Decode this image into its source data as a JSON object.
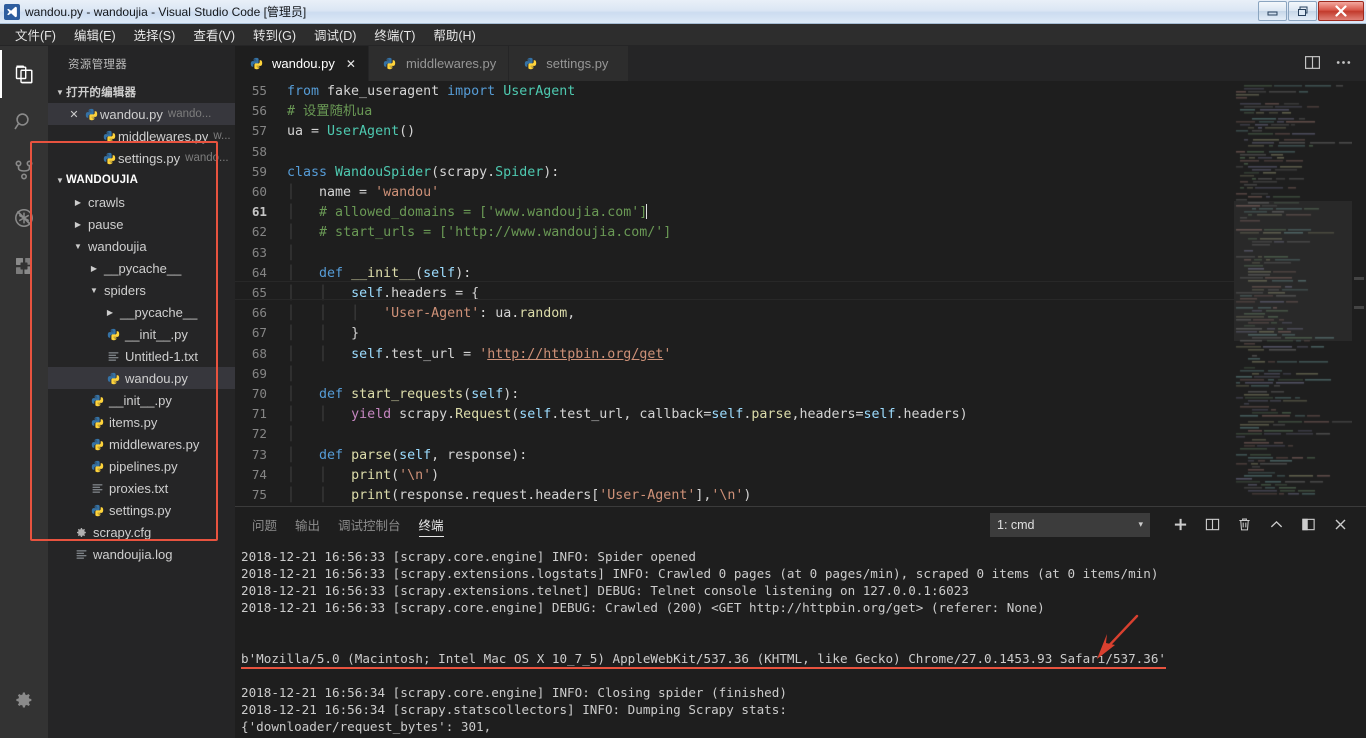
{
  "window": {
    "title": "wandou.py - wandoujia - Visual Studio Code [管理员]",
    "app_icon": "vscode-icon",
    "minimize_label": "—",
    "maximize_label": "❐",
    "close_label": "✕"
  },
  "menubar": {
    "items": [
      {
        "label": "文件(F)",
        "name": "menu-file"
      },
      {
        "label": "编辑(E)",
        "name": "menu-edit"
      },
      {
        "label": "选择(S)",
        "name": "menu-selection"
      },
      {
        "label": "查看(V)",
        "name": "menu-view"
      },
      {
        "label": "转到(G)",
        "name": "menu-go"
      },
      {
        "label": "调试(D)",
        "name": "menu-debug"
      },
      {
        "label": "终端(T)",
        "name": "menu-terminal"
      },
      {
        "label": "帮助(H)",
        "name": "menu-help"
      }
    ]
  },
  "activitybar": {
    "items": [
      {
        "icon": "files-explorer-icon",
        "active": true
      },
      {
        "icon": "search-icon",
        "active": false
      },
      {
        "icon": "source-control-icon",
        "active": false
      },
      {
        "icon": "debug-no-run-icon",
        "active": false
      },
      {
        "icon": "extensions-icon",
        "active": false
      }
    ],
    "bottom": [
      {
        "icon": "gear-icon",
        "active": false
      }
    ]
  },
  "sidebar": {
    "title": "资源管理器",
    "open_editors": {
      "label": "打开的编辑器",
      "expanded": true,
      "items": [
        {
          "name": "wandou.py",
          "desc": "wando...",
          "icon": "python-icon",
          "selected": true,
          "has_close": true
        },
        {
          "name": "middlewares.py",
          "desc": "w...",
          "icon": "python-icon",
          "selected": false,
          "has_close": false
        },
        {
          "name": "settings.py",
          "desc": "wando...",
          "icon": "python-icon",
          "selected": false,
          "has_close": false
        }
      ]
    },
    "project": {
      "label": "WANDOUJIA",
      "expanded": true,
      "tree": [
        {
          "label": "crawls",
          "type": "folder",
          "depth": 1,
          "expanded": false
        },
        {
          "label": "pause",
          "type": "folder",
          "depth": 1,
          "expanded": false
        },
        {
          "label": "wandoujia",
          "type": "folder",
          "depth": 1,
          "expanded": true
        },
        {
          "label": "__pycache__",
          "type": "folder",
          "depth": 2,
          "expanded": false
        },
        {
          "label": "spiders",
          "type": "folder",
          "depth": 2,
          "expanded": true
        },
        {
          "label": "__pycache__",
          "type": "folder",
          "depth": 3,
          "expanded": false
        },
        {
          "label": "__init__.py",
          "type": "python",
          "depth": 3
        },
        {
          "label": "Untitled-1.txt",
          "type": "text",
          "depth": 3
        },
        {
          "label": "wandou.py",
          "type": "python",
          "depth": 3,
          "selected": true
        },
        {
          "label": "__init__.py",
          "type": "python",
          "depth": 2
        },
        {
          "label": "items.py",
          "type": "python",
          "depth": 2
        },
        {
          "label": "middlewares.py",
          "type": "python",
          "depth": 2
        },
        {
          "label": "pipelines.py",
          "type": "python",
          "depth": 2
        },
        {
          "label": "proxies.txt",
          "type": "text",
          "depth": 2
        },
        {
          "label": "settings.py",
          "type": "python",
          "depth": 2
        },
        {
          "label": "scrapy.cfg",
          "type": "config",
          "depth": 1
        },
        {
          "label": "wandoujia.log",
          "type": "text",
          "depth": 1
        }
      ]
    }
  },
  "editor": {
    "tabs": [
      {
        "label": "wandou.py",
        "icon": "python-icon",
        "active": true,
        "closable": true
      },
      {
        "label": "middlewares.py",
        "icon": "python-icon",
        "active": false,
        "closable": false
      },
      {
        "label": "settings.py",
        "icon": "python-icon",
        "active": false,
        "closable": false
      }
    ],
    "actions": [
      {
        "icon": "split-editor-icon"
      },
      {
        "icon": "more-actions-icon"
      }
    ],
    "first_visible_line": 54,
    "cursor_line": 61,
    "lines": [
      {
        "n": 55,
        "text": "from fake_useragent import UserAgent"
      },
      {
        "n": 56,
        "text": "# 设置随机ua"
      },
      {
        "n": 57,
        "text": "ua = UserAgent()"
      },
      {
        "n": 58,
        "text": ""
      },
      {
        "n": 59,
        "text": "class WandouSpider(scrapy.Spider):"
      },
      {
        "n": 60,
        "text": "    name = 'wandou'"
      },
      {
        "n": 61,
        "text": "    # allowed_domains = ['www.wandoujia.com']"
      },
      {
        "n": 62,
        "text": "    # start_urls = ['http://www.wandoujia.com/']"
      },
      {
        "n": 63,
        "text": ""
      },
      {
        "n": 64,
        "text": "    def __init__(self):"
      },
      {
        "n": 65,
        "text": "        self.headers = {"
      },
      {
        "n": 66,
        "text": "            'User-Agent': ua.random,"
      },
      {
        "n": 67,
        "text": "        }"
      },
      {
        "n": 68,
        "text": "        self.test_url = 'http://httpbin.org/get'"
      },
      {
        "n": 69,
        "text": ""
      },
      {
        "n": 70,
        "text": "    def start_requests(self):"
      },
      {
        "n": 71,
        "text": "        yield scrapy.Request(self.test_url, callback=self.parse,headers=self.headers)"
      },
      {
        "n": 72,
        "text": ""
      },
      {
        "n": 73,
        "text": "    def parse(self, response):"
      },
      {
        "n": 74,
        "text": "        print('\\n')"
      },
      {
        "n": 75,
        "text": "        print(response.request.headers['User-Agent'],'\\n')"
      },
      {
        "n": 76,
        "text": ""
      }
    ]
  },
  "panel": {
    "tabs": [
      {
        "label": "问题",
        "active": false
      },
      {
        "label": "输出",
        "active": false
      },
      {
        "label": "调试控制台",
        "active": false
      },
      {
        "label": "终端",
        "active": true
      }
    ],
    "terminal_select": {
      "value": "1: cmd",
      "caret": "▾"
    },
    "actions": [
      {
        "icon": "add-terminal-icon",
        "label": "+"
      },
      {
        "icon": "split-terminal-icon"
      },
      {
        "icon": "trash-icon"
      },
      {
        "icon": "chevron-up-icon"
      },
      {
        "icon": "maximize-panel-icon"
      },
      {
        "icon": "close-panel-icon"
      }
    ],
    "terminal_lines": [
      {
        "text": "2018-12-21 16:56:33 [scrapy.core.engine] INFO: Spider opened",
        "highlight": false
      },
      {
        "text": "2018-12-21 16:56:33 [scrapy.extensions.logstats] INFO: Crawled 0 pages (at 0 pages/min), scraped 0 items (at 0 items/min)",
        "highlight": false
      },
      {
        "text": "2018-12-21 16:56:33 [scrapy.extensions.telnet] DEBUG: Telnet console listening on 127.0.0.1:6023",
        "highlight": false
      },
      {
        "text": "2018-12-21 16:56:33 [scrapy.core.engine] DEBUG: Crawled (200) <GET http://httpbin.org/get> (referer: None)",
        "highlight": false
      },
      {
        "text": "",
        "highlight": false
      },
      {
        "text": "",
        "highlight": false
      },
      {
        "text": "b'Mozilla/5.0 (Macintosh; Intel Mac OS X 10_7_5) AppleWebKit/537.36 (KHTML, like Gecko) Chrome/27.0.1453.93 Safari/537.36'",
        "highlight": true
      },
      {
        "text": "",
        "highlight": false
      },
      {
        "text": "2018-12-21 16:56:34 [scrapy.core.engine] INFO: Closing spider (finished)",
        "highlight": false
      },
      {
        "text": "2018-12-21 16:56:34 [scrapy.statscollectors] INFO: Dumping Scrapy stats:",
        "highlight": false
      },
      {
        "text": "{'downloader/request_bytes': 301,",
        "highlight": false
      }
    ]
  },
  "annotations": {
    "accent_color": "#e8533f",
    "explorer_box": "red-rectangle-around-explorer-tree",
    "arrow": "red-arrow-pointing-to-useragent-line",
    "underline": "red-underline-under-useragent-line"
  }
}
